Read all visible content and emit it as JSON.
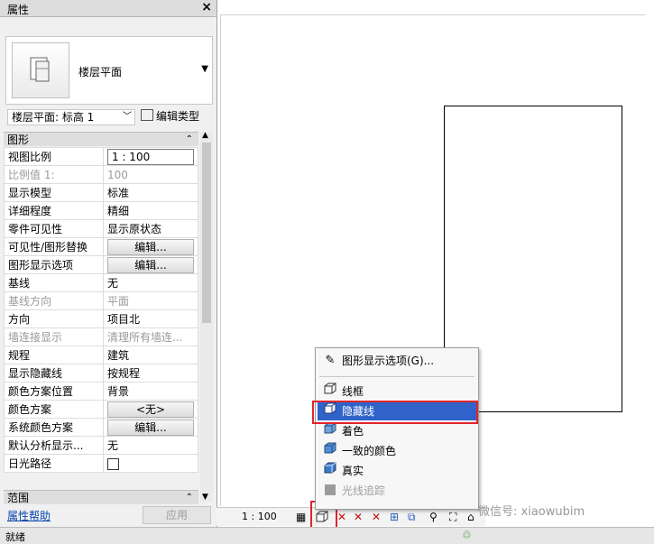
{
  "panel": {
    "title": "属性",
    "close_icon": "close-icon",
    "type_selector": {
      "label": "楼层平面"
    },
    "instance": {
      "selected": "楼层平面: 标高 1",
      "edit_type_label": "编辑类型"
    },
    "groups": {
      "graphics": "图形",
      "extents": "范围"
    },
    "properties": [
      {
        "key": "视图比例",
        "value": "1 : 100",
        "kind": "input"
      },
      {
        "key": "比例值 1:",
        "value": "100",
        "kind": "text",
        "dim": true
      },
      {
        "key": "显示模型",
        "value": "标准",
        "kind": "text"
      },
      {
        "key": "详细程度",
        "value": "精细",
        "kind": "text"
      },
      {
        "key": "零件可见性",
        "value": "显示原状态",
        "kind": "text"
      },
      {
        "key": "可见性/图形替换",
        "value": "编辑...",
        "kind": "button"
      },
      {
        "key": "图形显示选项",
        "value": "编辑...",
        "kind": "button"
      },
      {
        "key": "基线",
        "value": "无",
        "kind": "text"
      },
      {
        "key": "基线方向",
        "value": "平面",
        "kind": "text",
        "dim": true
      },
      {
        "key": "方向",
        "value": "项目北",
        "kind": "text"
      },
      {
        "key": "墙连接显示",
        "value": "清理所有墙连...",
        "kind": "text",
        "dim": true
      },
      {
        "key": "规程",
        "value": "建筑",
        "kind": "text"
      },
      {
        "key": "显示隐藏线",
        "value": "按规程",
        "kind": "text"
      },
      {
        "key": "颜色方案位置",
        "value": "背景",
        "kind": "text"
      },
      {
        "key": "颜色方案",
        "value": "<无>",
        "kind": "button"
      },
      {
        "key": "系统颜色方案",
        "value": "编辑...",
        "kind": "button"
      },
      {
        "key": "默认分析显示...",
        "value": "无",
        "kind": "text"
      },
      {
        "key": "日光路径",
        "value": "",
        "kind": "checkbox"
      }
    ],
    "help_link": "属性帮助",
    "apply_label": "应用"
  },
  "view_bar": {
    "scale": "1 : 100"
  },
  "visual_style_menu": {
    "items": [
      {
        "label": "图形显示选项(G)...",
        "icon": "pencil-icon"
      },
      {
        "label": "线框",
        "icon": "wireframe-icon"
      },
      {
        "label": "隐藏线",
        "icon": "hidden-line-icon",
        "selected": true
      },
      {
        "label": "着色",
        "icon": "shaded-icon"
      },
      {
        "label": "一致的颜色",
        "icon": "consistent-colors-icon"
      },
      {
        "label": "真实",
        "icon": "realistic-icon"
      },
      {
        "label": "光线追踪",
        "icon": "ray-trace-icon",
        "disabled": true
      }
    ]
  },
  "status": {
    "text": "就绪"
  },
  "watermark": "微信号: xiaowubim",
  "colors": {
    "selection": "#3063c9",
    "highlight": "#e0252b",
    "link": "#0645ad"
  }
}
